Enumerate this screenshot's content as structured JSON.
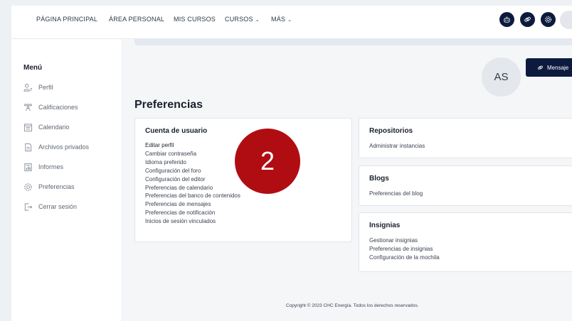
{
  "topnav": {
    "items": [
      {
        "label": "PÁGINA PRINCIPAL"
      },
      {
        "label": "ÁREA PERSONAL"
      },
      {
        "label": "MIS CURSOS"
      },
      {
        "label": "CURSOS",
        "dropdown": true
      },
      {
        "label": "MÁS",
        "dropdown": true
      }
    ],
    "action_icons": [
      "robot-icon",
      "link-icon",
      "gear-icon"
    ]
  },
  "sidebar": {
    "title": "Menú",
    "items": [
      {
        "label": "Perfil",
        "icon": "profile-icon"
      },
      {
        "label": "Calificaciones",
        "icon": "grades-icon"
      },
      {
        "label": "Calendario",
        "icon": "calendar-icon"
      },
      {
        "label": "Archivos privados",
        "icon": "file-icon"
      },
      {
        "label": "Informes",
        "icon": "report-icon"
      },
      {
        "label": "Preferencias",
        "icon": "gear-icon"
      },
      {
        "label": "Cerrar sesión",
        "icon": "logout-icon"
      }
    ]
  },
  "profile": {
    "initials": "AS",
    "message_button": "Mensaje"
  },
  "page": {
    "title": "Preferencias",
    "step_badge": "2"
  },
  "cards": {
    "account": {
      "title": "Cuenta de usuario",
      "links": [
        "Editar perfil",
        "Cambiar contraseña",
        "Idioma preferido",
        "Configuración del foro",
        "Configuración del editor",
        "Preferencias de calendario",
        "Preferencias del banco de contenidos",
        "Preferencias de mensajes",
        "Preferencias de notificación",
        "Inicios de sesión vinculados"
      ]
    },
    "repositories": {
      "title": "Repositorios",
      "links": [
        "Administrar instancias"
      ]
    },
    "blogs": {
      "title": "Blogs",
      "links": [
        "Preferencias del blog"
      ]
    },
    "badges": {
      "title": "Insignias",
      "links": [
        "Gestionar insignias",
        "Preferencias de insignias",
        "Configuración de la mochila"
      ]
    }
  },
  "footer": {
    "copyright": "Copyright © 2023 CHC Energía. Todos los derechos reservados."
  },
  "colors": {
    "brand_navy": "#0c1b3d",
    "badge_red": "#b00d13"
  }
}
